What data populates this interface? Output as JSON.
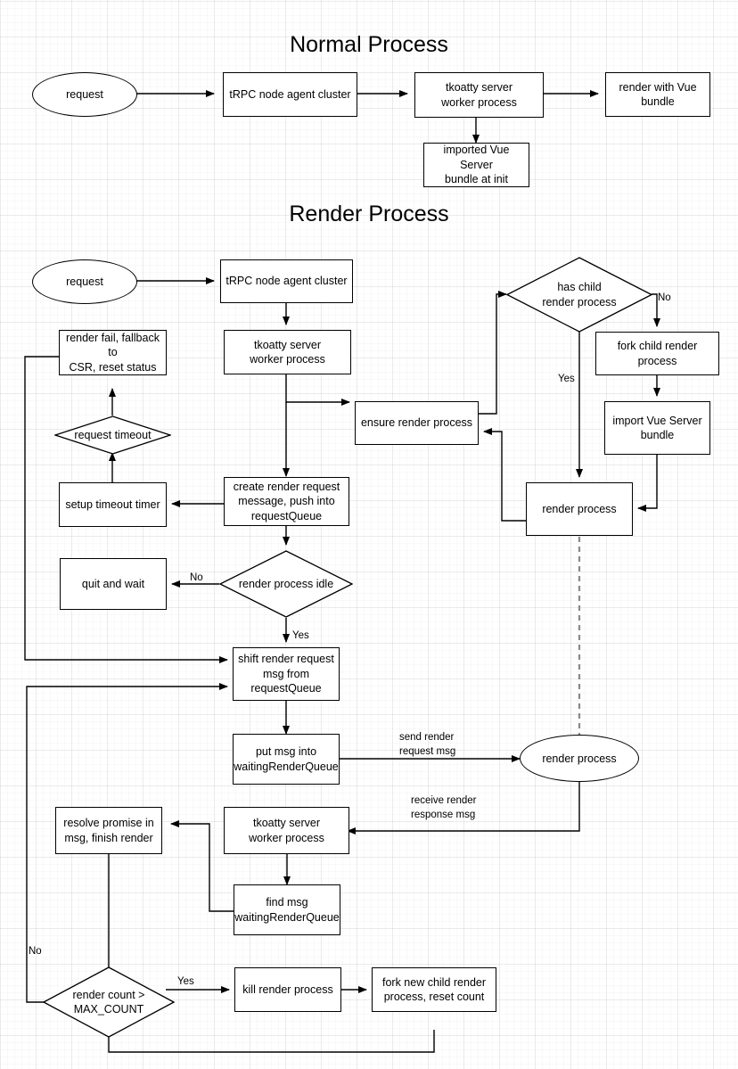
{
  "titles": {
    "normal": "Normal Process",
    "render": "Render Process"
  },
  "normal_process": {
    "request": "request",
    "trpc": "tRPC node agent cluster",
    "worker": "tkoatty server\nworker process",
    "render_vue": "render with Vue\nbundle",
    "imported": "imported Vue Server\nbundle at init"
  },
  "render_process": {
    "request": "request",
    "trpc": "tRPC node agent cluster",
    "worker": "tkoatty server\nworker process",
    "render_fail": "render fail, fallback to\nCSR, reset status",
    "request_timeout": "request timeout",
    "setup_timer": "setup timeout timer",
    "quit_wait": "quit and wait",
    "ensure_render": "ensure render process",
    "create_msg": "create render request\nmessage, push into\nrequestQueue",
    "idle_check": "render process idle",
    "shift_msg": "shift render request\nmsg from\nrequestQueue",
    "put_msg": "put msg into\nwaitingRenderQueue",
    "has_child": "has child\nrender process",
    "fork_child": "fork child render process",
    "import_bundle": "import Vue Server\nbundle",
    "render_proc_box": "render process",
    "render_proc_ellipse": "render process",
    "worker2": "tkoatty server\nworker process",
    "find_msg": "find msg\nwaitingRenderQueue",
    "resolve_promise": "resolve promise in\nmsg, finish render",
    "count_check": "render count >\nMAX_COUNT",
    "kill_render": "kill render process",
    "fork_new": "fork new child render\nprocess, reset count"
  },
  "edge_labels": {
    "no_has_child": "No",
    "yes_has_child": "Yes",
    "no_idle": "No",
    "yes_idle": "Yes",
    "send_render": "send render\nrequest msg",
    "receive_render": "receive render\nresponse msg",
    "no_count": "No",
    "yes_count": "Yes"
  },
  "colors": {
    "stroke": "#000000",
    "fill": "#ffffff",
    "grid": "#e8e8e8"
  }
}
